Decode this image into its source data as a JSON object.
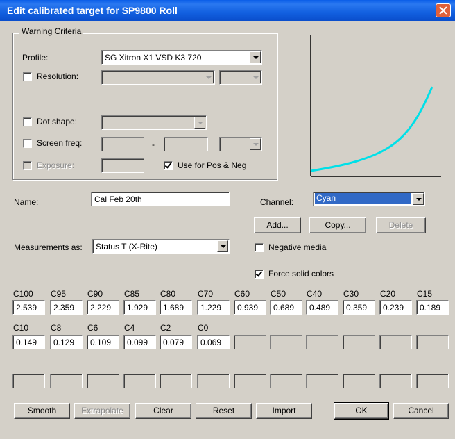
{
  "window": {
    "title": "Edit calibrated target for SP9800 Roll"
  },
  "warning": {
    "legend": "Warning Criteria",
    "profile_label": "Profile:",
    "profile_value": "SG  Xitron X1 VSD K3 720",
    "resolution_label": "Resolution:",
    "dot_shape_label": "Dot shape:",
    "screen_freq_label": "Screen freq:",
    "screen_freq_sep": "-",
    "exposure_label": "Exposure:",
    "use_for_label": "Use for Pos & Neg"
  },
  "name": {
    "label": "Name:",
    "value": "Cal Feb 20th"
  },
  "channel": {
    "label": "Channel:",
    "value": "Cyan"
  },
  "buttons": {
    "add": "Add...",
    "copy": "Copy...",
    "delete": "Delete"
  },
  "measurements": {
    "label": "Measurements as:",
    "value": "Status T (X-Rite)"
  },
  "negative_media_label": "Negative media",
  "force_solid_label": "Force solid colors",
  "curve_color": "#00e0e8",
  "grid_row1": [
    {
      "label": "C100",
      "value": "2.539"
    },
    {
      "label": "C95",
      "value": "2.359"
    },
    {
      "label": "C90",
      "value": "2.229"
    },
    {
      "label": "C85",
      "value": "1.929"
    },
    {
      "label": "C80",
      "value": "1.689"
    },
    {
      "label": "C70",
      "value": "1.229"
    },
    {
      "label": "C60",
      "value": "0.939"
    },
    {
      "label": "C50",
      "value": "0.689"
    },
    {
      "label": "C40",
      "value": "0.489"
    },
    {
      "label": "C30",
      "value": "0.359"
    },
    {
      "label": "C20",
      "value": "0.239"
    },
    {
      "label": "C15",
      "value": "0.189"
    }
  ],
  "grid_row2": [
    {
      "label": "C10",
      "value": "0.149"
    },
    {
      "label": "C8",
      "value": "0.129"
    },
    {
      "label": "C6",
      "value": "0.109"
    },
    {
      "label": "C4",
      "value": "0.099"
    },
    {
      "label": "C2",
      "value": "0.079"
    },
    {
      "label": "C0",
      "value": "0.069"
    }
  ],
  "bottom_buttons": {
    "smooth": "Smooth",
    "extrapolate": "Extrapolate",
    "clear": "Clear",
    "reset": "Reset",
    "import": "Import",
    "ok": "OK",
    "cancel": "Cancel"
  }
}
